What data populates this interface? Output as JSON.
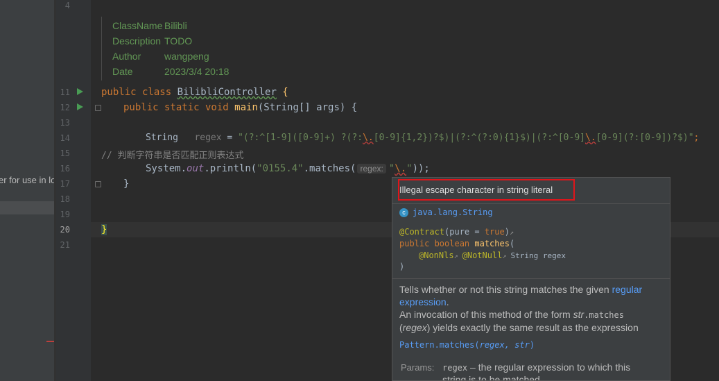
{
  "project_panel": {
    "visible_text": "er for use in lo"
  },
  "gutter": {
    "line_numbers": [
      "4",
      "11",
      "12",
      "13",
      "14",
      "15",
      "16",
      "17",
      "18",
      "19",
      "20",
      "21"
    ]
  },
  "doc_comment": {
    "class_name_label": "ClassName",
    "class_name_value": "Bilibli",
    "description_label": "Description",
    "description_value": "TODO",
    "author_label": "Author",
    "author_value": "wangpeng",
    "date_label": "Date",
    "date_value": "2023/3/4 20:18"
  },
  "code": {
    "l11_kw": "public class ",
    "l11_name": "BilibliController",
    "l11_brace": " {",
    "l12_kw": "public static void ",
    "l12_fn": "main",
    "l12_rest": "(String[] args) {",
    "l14_type": "String   ",
    "l14_var": "regex",
    "l14_eq": " = ",
    "l14_s1": "\"(?:^[1-9]([0-9]+) ?(?:",
    "l14_esc1": "\\.",
    "l14_s2": "[0-9]{1,2})?$)|(?:^(?:0){1}$)|(?:^[0-9]",
    "l14_esc2": "\\.",
    "l14_s3": "[0-9](?:[0-9])?$)\"",
    "l14_semi": ";",
    "l15_comment": "// 判断字符串是否匹配正则表达式",
    "l16_obj": "System.",
    "l16_out": "out",
    "l16_print": ".println(",
    "l16_str": "\"0155.4\"",
    "l16_match": ".matches(",
    "l16_hint": "regex:",
    "l16_q1": "\"",
    "l16_esc": "\\.",
    "l16_q2": "\"",
    "l16_end": "));",
    "l17_brace": "}",
    "l20_brace": "}"
  },
  "popup": {
    "error": "Illegal escape character in string literal",
    "class_icon": "c",
    "class_name": "java.lang.String",
    "sig1_ann": "@Contract",
    "sig1_rest": "(pure = ",
    "sig1_true": "true",
    "sig1_close": ")",
    "sig2_kw": "public boolean ",
    "sig2_fn": "matches",
    "sig2_paren": "(",
    "sig3_ann1": "@NonNls",
    "sig3_ann2": "@NotNull",
    "sig3_param": "String regex",
    "sig4": ")",
    "desc1": "Tells whether or not this string matches the given ",
    "desc_link": "regular expression",
    "desc2": ".",
    "desc3": "An invocation of this method of the form ",
    "desc3_code1": "str",
    "desc3_code2": ".matches",
    "desc4_a": "(",
    "desc4_b": "regex",
    "desc4_c": ") yields exactly the same result as the expression",
    "pattern_link_a": "Pattern",
    "pattern_link_b": ".matches(",
    "pattern_link_c": "regex, str",
    "pattern_link_d": ")",
    "params_label": "Params:",
    "params_name": "regex",
    "params_text": " – the regular expression to which this string is to be matched"
  },
  "colors": {
    "editor_bg": "#2b2b2b",
    "keyword": "#cc7832",
    "string": "#6a8759",
    "function": "#ffc66d",
    "doc": "#629755",
    "link": "#589df6",
    "error_box": "#e0151a"
  }
}
